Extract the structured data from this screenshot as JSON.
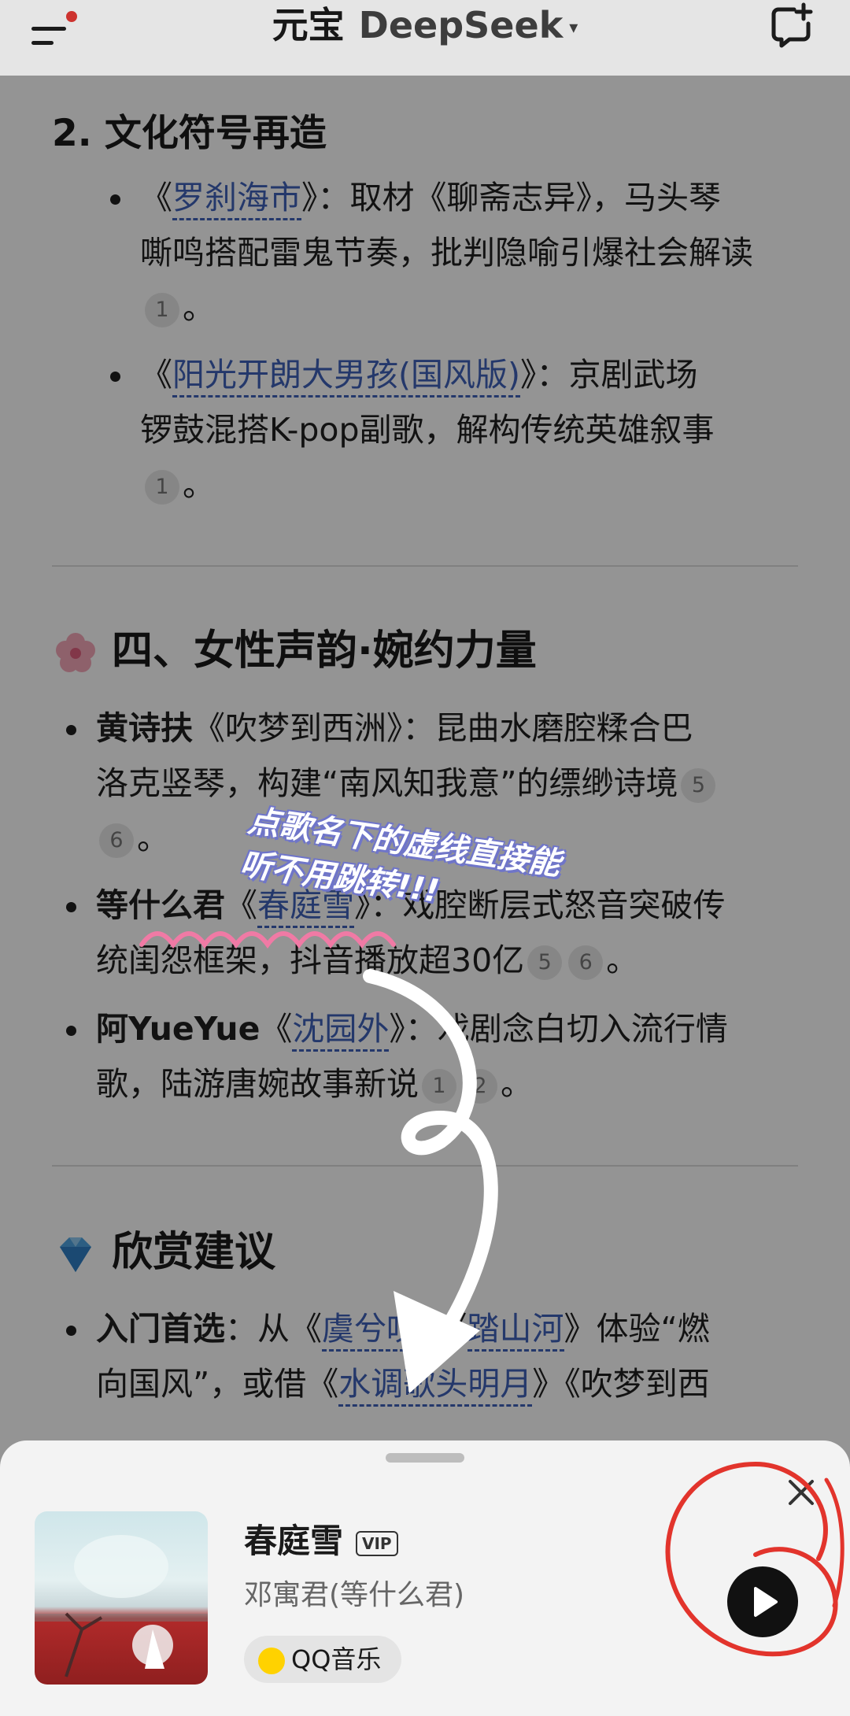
{
  "header": {
    "title_primary": "元宝",
    "title_secondary": "DeepSeek",
    "caret": "▾"
  },
  "doc": {
    "section2_heading": "2. 文化符号再造",
    "items_culture": [
      {
        "pre": "《",
        "link": "罗刹海市",
        "post": "》：取材《聊斋志异》，马头琴",
        "line2": "嘶鸣搭配雷鬼节奏，批判隐喻引爆社会解读",
        "cites": [
          "1"
        ],
        "end": "。"
      },
      {
        "pre": "《",
        "link": "阳光开朗大男孩(国风版)",
        "post": "》：京剧武场",
        "line2": "锣鼓混搭K-pop副歌，解构传统英雄叙事",
        "cites": [
          "1"
        ],
        "end": "。"
      }
    ],
    "section4_heading": "四、女性声韵·婉约力量",
    "items_female": [
      {
        "name": "黄诗扶",
        "pre": "《",
        "text": "吹梦到西洲",
        "post": "》：昆曲水磨腔糅合巴",
        "line2": "洛克竖琴，构建“南风知我意”的缥缈诗境",
        "cites": [
          "5",
          "6"
        ],
        "end": "。"
      },
      {
        "name": "等什么君",
        "pre": "《",
        "link": "春庭雪",
        "post": "》：戏腔断层式怒音突破传",
        "line2": "统闺怨框架，抖音播放超30亿",
        "cites": [
          "5",
          "6"
        ],
        "end": "。"
      },
      {
        "name": "阿YueYue",
        "pre": "《",
        "link": "沈园外",
        "post": "》：戏剧念白切入流行情",
        "line2": "歌，陆游唐婉故事新说",
        "cites": [
          "1",
          "2"
        ],
        "end": "。"
      }
    ],
    "section_tips_heading": "欣赏建议",
    "tips_line1_label": "入门首选",
    "tips_line1_a": "：从《",
    "tips_line1_link1": "虞兮叹",
    "tips_line1_b": "》《",
    "tips_line1_link2": "踏山河",
    "tips_line1_c": "》体验“燃",
    "tips_line2_a": "向国风”，或借《",
    "tips_line2_link": "水调歌头明月",
    "tips_line2_b": "》《吹梦到西"
  },
  "annotation": {
    "line1": "点歌名下的虚线直接能",
    "line2": "听不用跳转!!!"
  },
  "player": {
    "song_title": "春庭雪",
    "badge": "VIP",
    "artist": "邓寓君(等什么君)",
    "source": "QQ音乐"
  },
  "icons": {
    "menu": "menu-icon",
    "new_chat": "new-chat-icon",
    "close": "close-icon",
    "play": "play-icon",
    "blossom": "cherry-blossom-icon",
    "gem": "gem-icon"
  },
  "colors": {
    "link": "#3f61b8",
    "annotation_red": "#e2342c",
    "sticker_shadow": "#6f75c9"
  }
}
